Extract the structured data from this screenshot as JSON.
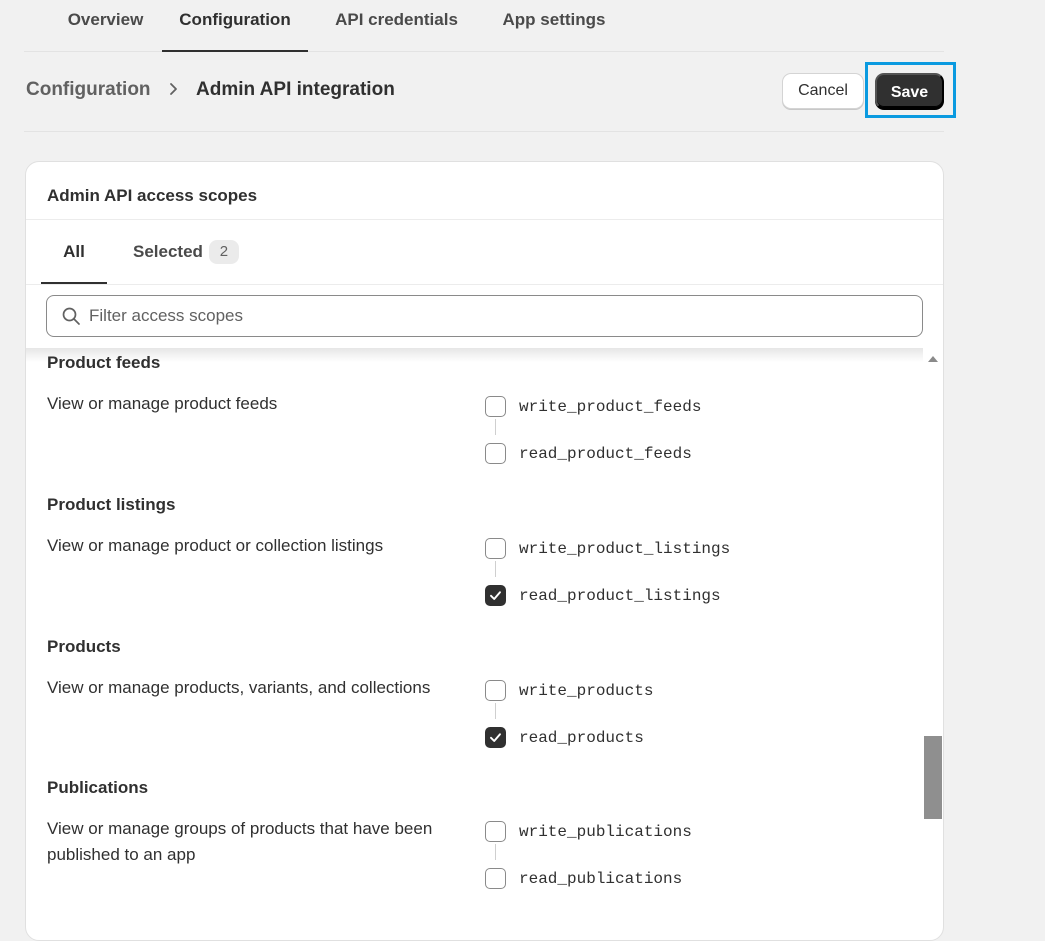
{
  "tabs": [
    {
      "label": "Overview"
    },
    {
      "label": "Configuration"
    },
    {
      "label": "API credentials"
    },
    {
      "label": "App settings"
    }
  ],
  "breadcrumb": {
    "root": "Configuration",
    "current": "Admin API integration"
  },
  "actions": {
    "cancel": "Cancel",
    "save": "Save"
  },
  "card": {
    "title": "Admin API access scopes",
    "tabs": {
      "all": "All",
      "selected": "Selected",
      "selected_count": "2"
    },
    "filter_placeholder": "Filter access scopes"
  },
  "groups": [
    {
      "title": "Product feeds",
      "desc": "View or manage product feeds",
      "scopes": [
        {
          "name": "write_product_feeds",
          "checked": false
        },
        {
          "name": "read_product_feeds",
          "checked": false
        }
      ]
    },
    {
      "title": "Product listings",
      "desc": "View or manage product or collection listings",
      "scopes": [
        {
          "name": "write_product_listings",
          "checked": false
        },
        {
          "name": "read_product_listings",
          "checked": true
        }
      ]
    },
    {
      "title": "Products",
      "desc": "View or manage products, variants, and collections",
      "scopes": [
        {
          "name": "write_products",
          "checked": false
        },
        {
          "name": "read_products",
          "checked": true
        }
      ]
    },
    {
      "title": "Publications",
      "desc": "View or manage groups of products that have been published to an app",
      "scopes": [
        {
          "name": "write_publications",
          "checked": false
        },
        {
          "name": "read_publications",
          "checked": false
        }
      ]
    }
  ],
  "colors": {
    "accent_highlight": "#0a9ae0",
    "primary_button": "#303030"
  }
}
